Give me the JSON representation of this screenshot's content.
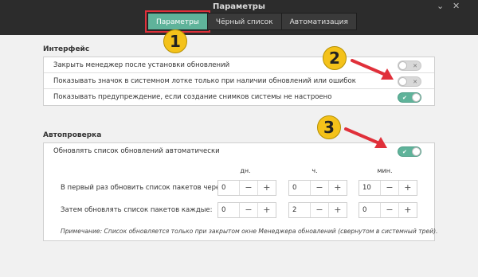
{
  "window": {
    "title": "Параметры"
  },
  "tabs": [
    {
      "label": "Параметры"
    },
    {
      "label": "Чёрный список"
    },
    {
      "label": "Автоматизация"
    }
  ],
  "interface": {
    "title": "Интерфейс",
    "rows": [
      {
        "label": "Закрыть менеджер после установки обновлений",
        "toggle": "off"
      },
      {
        "label": "Показывать значок в системном лотке только при наличии обновлений или ошибок",
        "toggle": "off"
      },
      {
        "label": "Показывать предупреждение, если создание снимков системы не настроено",
        "toggle": "on"
      }
    ]
  },
  "autocheck": {
    "title": "Автопроверка",
    "auto_label": "Обновлять список обновлений автоматически",
    "auto_toggle": "on",
    "columns": [
      "дн.",
      "ч.",
      "мин."
    ],
    "first_label": "В первый раз обновить список пакетов через:",
    "first_values": [
      "0",
      "0",
      "10"
    ],
    "then_label": "Затем обновлять список пакетов каждые:",
    "then_values": [
      "0",
      "2",
      "0"
    ],
    "note": "Примечание: Список обновляется только при закрытом окне Менеджера обновлений (свернутом в системный трей)."
  },
  "controls": {
    "minus": "−",
    "plus": "+",
    "check": "✔",
    "cross": "✕"
  },
  "annotations": [
    "1",
    "2",
    "3"
  ],
  "colors": {
    "accent": "#5fb39a",
    "highlight": "#e0303a",
    "badge": "#f4c21a"
  }
}
